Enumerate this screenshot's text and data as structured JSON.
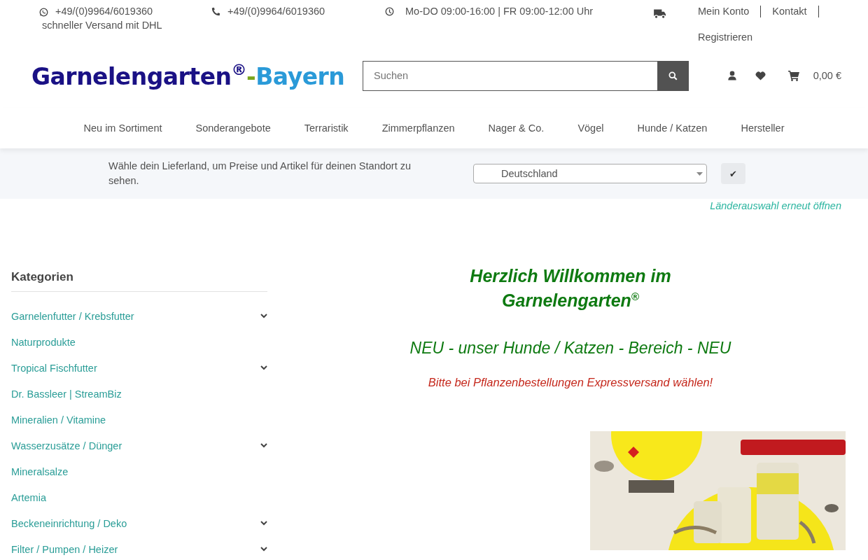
{
  "topbar": {
    "whatsapp": "+49/(0)9964/6019360",
    "shipping_note": "schneller Versand mit DHL",
    "phone": "+49/(0)9964/6019360",
    "hours": "Mo-DO 09:00-16:00 | FR 09:00-12:00 Uhr",
    "links": [
      "Mein Konto",
      "Kontakt",
      "Registrieren"
    ]
  },
  "logo": {
    "name": "Garnelengarten",
    "mark": "®",
    "dash": "-",
    "region": "Bayern"
  },
  "search": {
    "placeholder": "Suchen"
  },
  "cart": {
    "total": "0,00 €"
  },
  "nav": [
    "Neu im Sortiment",
    "Sonderangebote",
    "Terraristik",
    "Zimmerpflanzen",
    "Nager & Co.",
    "Vögel",
    "Hunde / Katzen",
    "Hersteller"
  ],
  "country_bar": {
    "text": "Wähle dein Lieferland, um Preise und Artikel für deinen Standort zu sehen.",
    "country": "Deutschland",
    "confirm": "✔",
    "reopen": "Länderauswahl erneut öffnen"
  },
  "sidebar": {
    "title": "Kategorien",
    "items": [
      {
        "label": "Garnelenfutter / Krebsfutter",
        "expandable": true
      },
      {
        "label": "Naturprodukte",
        "expandable": false
      },
      {
        "label": "Tropical Fischfutter",
        "expandable": true
      },
      {
        "label": "Dr. Bassleer | StreamBiz",
        "expandable": false
      },
      {
        "label": "Mineralien / Vitamine",
        "expandable": false
      },
      {
        "label": "Wasserzusätze / Dünger",
        "expandable": true
      },
      {
        "label": "Mineralsalze",
        "expandable": false
      },
      {
        "label": "Artemia",
        "expandable": false
      },
      {
        "label": "Beckeneinrichtung / Deko",
        "expandable": true
      },
      {
        "label": "Filter / Pumpen / Heizer",
        "expandable": true
      }
    ]
  },
  "main": {
    "welcome": "Herzlich Willkommen im Garnelengarten$^{®}$",
    "news": "NEU - unser Hunde / Katzen - Bereich - NEU",
    "notice": "Bitte bei Pflanzenbestellungen Expressversand wählen!"
  }
}
